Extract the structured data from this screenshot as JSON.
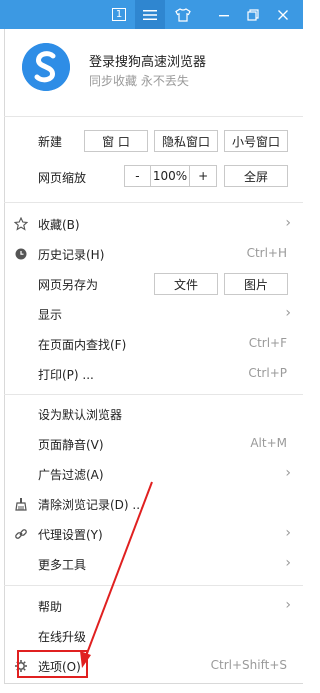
{
  "topbar": {
    "tab_count": "1",
    "menu_icon": "hamburger-menu-icon",
    "skin_icon": "tshirt-skin-icon",
    "minimize_icon": "minimize-icon",
    "restore_icon": "restore-icon",
    "close_icon": "close-icon"
  },
  "login": {
    "title": "登录搜狗高速浏览器",
    "subtitle": "同步收藏 永不丢失",
    "logo_icon": "sogou-s-logo-icon"
  },
  "new_row": {
    "label": "新建",
    "window": "窗 口",
    "private_window": "隐私窗口",
    "small_window": "小号窗口"
  },
  "zoom_row": {
    "label": "网页缩放",
    "minus": "-",
    "value": "100%",
    "plus": "+",
    "fullscreen": "全屏"
  },
  "menu": {
    "favorites": "收藏(B)",
    "history": "历史记录(H)",
    "history_shortcut": "Ctrl+H",
    "save_as": "网页另存为",
    "save_file": "文件",
    "save_image": "图片",
    "display": "显示",
    "find": "在页面内查找(F)",
    "find_shortcut": "Ctrl+F",
    "print": "打印(P) ...",
    "print_shortcut": "Ctrl+P",
    "set_default": "设为默认浏览器",
    "mute": "页面静音(V)",
    "mute_shortcut": "Alt+M",
    "adblock": "广告过滤(A)",
    "clear_history": "清除浏览记录(D) ...",
    "proxy": "代理设置(Y)",
    "more_tools": "更多工具",
    "help": "帮助",
    "online_upgrade": "在线升级",
    "options": "选项(O)",
    "options_shortcut": "Ctrl+Shift+S"
  },
  "colors": {
    "accent": "#3c99e3",
    "annotation": "#e02020"
  }
}
